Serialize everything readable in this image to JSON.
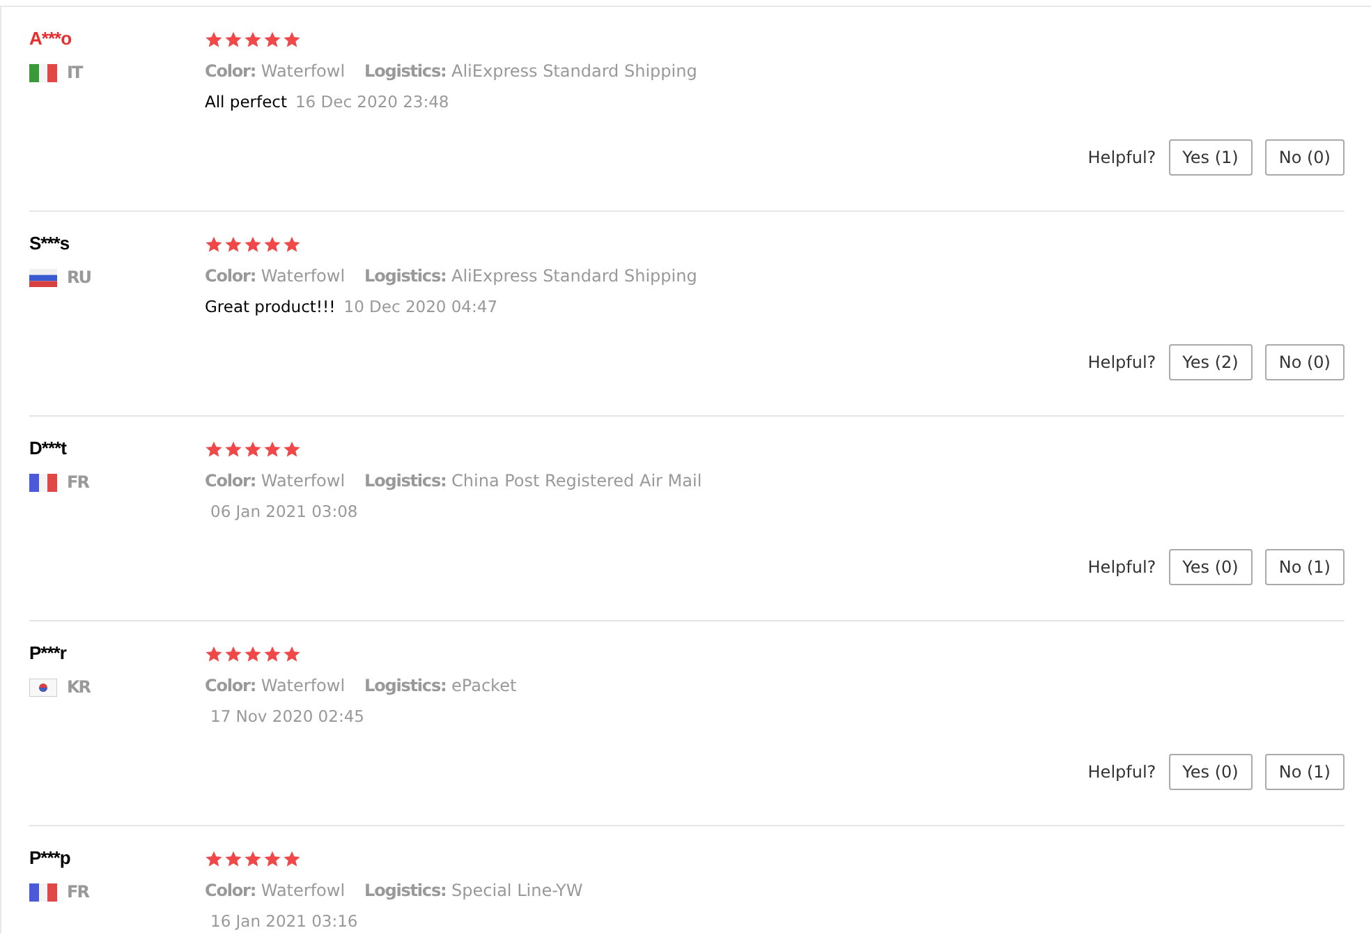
{
  "reviews": [
    {
      "name": "A***o",
      "color": "#e62e2e",
      "flag": {
        "kind": "it"
      },
      "country": "IT",
      "stars": 5,
      "color_label": "Color:",
      "color_value": "Waterfowl",
      "logistics_label": "Logistics:",
      "logistics_value": "AliExpress Standard Shipping",
      "text": "All perfect",
      "date": "16 Dec 2020 23:48",
      "helpful_label": "Helpful?",
      "yes": "Yes (1)",
      "no": "No (0)"
    },
    {
      "name": "S***s",
      "color": "#000000",
      "flag": {
        "kind": "ru"
      },
      "country": "RU",
      "stars": 5,
      "color_label": "Color:",
      "color_value": "Waterfowl",
      "logistics_label": "Logistics:",
      "logistics_value": "AliExpress Standard Shipping",
      "text": "Great product!!!",
      "date": "10 Dec 2020 04:47",
      "helpful_label": "Helpful?",
      "yes": "Yes (2)",
      "no": "No (0)"
    },
    {
      "name": "D***t",
      "color": "#000000",
      "flag": {
        "kind": "fr"
      },
      "country": "FR",
      "stars": 5,
      "color_label": "Color:",
      "color_value": "Waterfowl",
      "logistics_label": "Logistics:",
      "logistics_value": "China Post Registered Air Mail",
      "date": "06 Jan 2021 03:08",
      "helpful_label": "Helpful?",
      "yes": "Yes (0)",
      "no": "No (1)"
    },
    {
      "name": "P***r",
      "color": "#000000",
      "flag": {
        "kind": "kr"
      },
      "country": "KR",
      "stars": 5,
      "color_label": "Color:",
      "color_value": "Waterfowl",
      "logistics_label": "Logistics:",
      "logistics_value": "ePacket",
      "date": "17 Nov 2020 02:45",
      "helpful_label": "Helpful?",
      "yes": "Yes (0)",
      "no": "No (1)"
    },
    {
      "name": "P***p",
      "color": "#000000",
      "flag": {
        "kind": "fr"
      },
      "country": "FR",
      "stars": 5,
      "color_label": "Color:",
      "color_value": "Waterfowl",
      "logistics_label": "Logistics:",
      "logistics_value": "Special Line-YW",
      "date": "16 Jan 2021 03:16"
    }
  ]
}
